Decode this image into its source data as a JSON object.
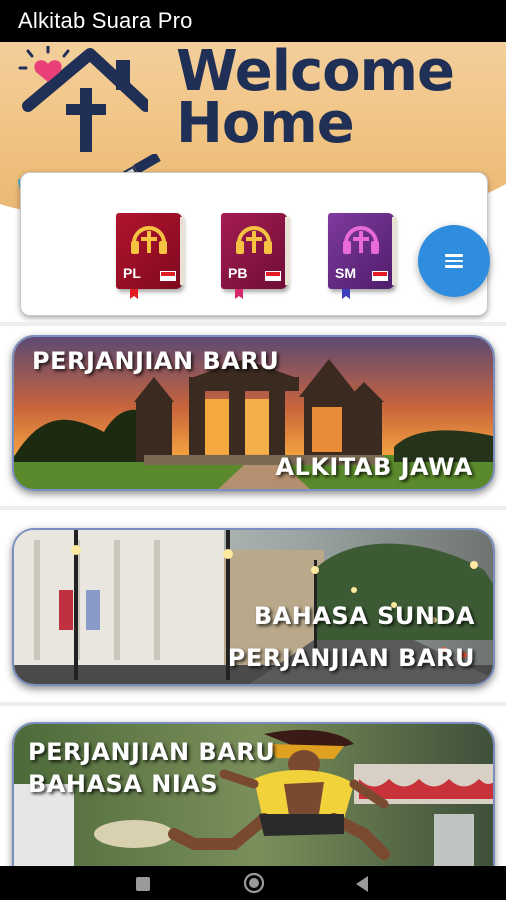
{
  "status_bar": {
    "title": "Alkitab Suara Pro"
  },
  "hero": {
    "welcome_line1": "Welcome",
    "welcome_line2": "Home",
    "colors": {
      "navy": "#1f2f56",
      "heart": "#e9407a",
      "brush": "#2ab4e6"
    }
  },
  "books": [
    {
      "label": "PL",
      "icon": "bible-headphone-icon",
      "color": "#9e1027"
    },
    {
      "label": "PB",
      "icon": "bible-headphone-icon",
      "color": "#8a1545"
    },
    {
      "label": "SM",
      "icon": "bible-headphone-icon",
      "color": "#6a2b87"
    }
  ],
  "fab": {
    "icon": "menu-icon",
    "color": "#2f8de0"
  },
  "banners": [
    {
      "top_text": "PERJANJIAN BARU",
      "bottom_text": "ALKITAB JAWA",
      "scene": "temple-gate-sunset"
    },
    {
      "line1": "BAHASA SUNDA",
      "line2": "PERJANJIAN BARU",
      "scene": "city-street-evening"
    },
    {
      "line1": "PERJANJIAN BARU",
      "line2": "BAHASA NIAS",
      "scene": "stone-jumping-dancer"
    }
  ],
  "nav_bar": {
    "items": [
      "recent-apps-icon",
      "home-icon",
      "back-icon"
    ]
  }
}
